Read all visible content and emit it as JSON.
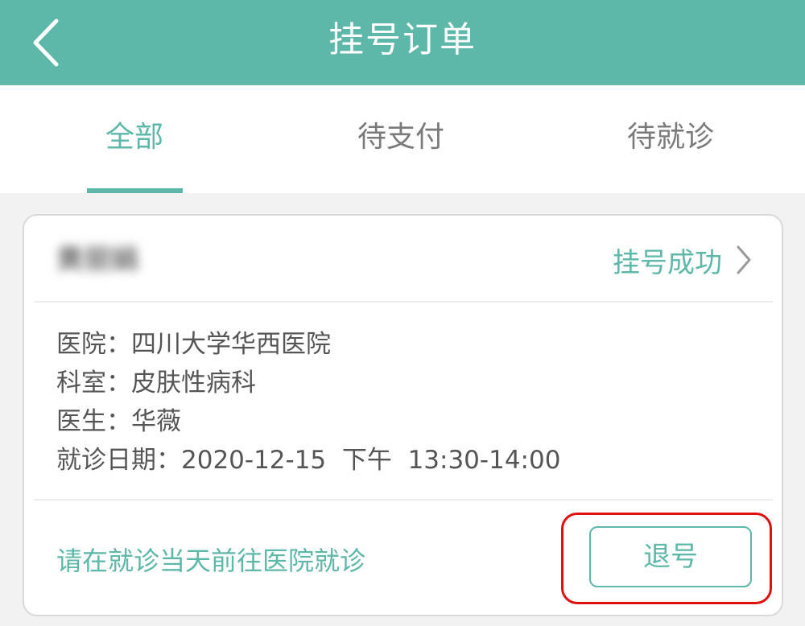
{
  "header": {
    "title": "挂号订单",
    "back_icon": "chevron-left-icon"
  },
  "tabs": [
    {
      "label": "全部",
      "active": true
    },
    {
      "label": "待支付",
      "active": false
    },
    {
      "label": "待就诊",
      "active": false
    }
  ],
  "order": {
    "patient_name": "黄丽娟",
    "status": "挂号成功",
    "details": [
      {
        "label": "医院：",
        "value": "四川大学华西医院"
      },
      {
        "label": "科室：",
        "value": "皮肤性病科"
      },
      {
        "label": "医生：",
        "value": "华薇"
      },
      {
        "label": "就诊日期：",
        "value": "2020-12-15  下午  13:30-14:00"
      }
    ],
    "notice": "请在就诊当天前往医院就诊",
    "cancel_label": "退号"
  },
  "colors": {
    "accent": "#5eb8a9",
    "highlight": "#e01010",
    "text": "#555555"
  }
}
